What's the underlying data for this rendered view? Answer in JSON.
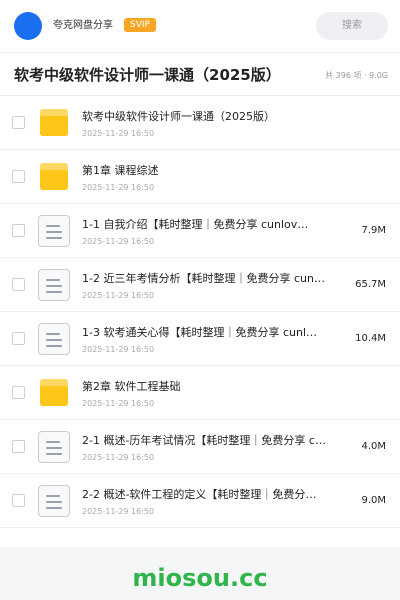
{
  "topbar": {
    "username": "夸克网盘分享",
    "badge": "SVIP",
    "search_label": "搜索",
    "avatar_color": "#1a6ff0"
  },
  "header": {
    "title": "软考中级软件设计师一课通（2025版）",
    "count": "共 396 项 · 9.0G"
  },
  "files": [
    {
      "type": "folder",
      "name": "软考中级软件设计师一课通（2025版）",
      "date": "2025-11-29 16:50",
      "size": ""
    },
    {
      "type": "folder",
      "name": "第1章 课程综述",
      "date": "2025-11-29 16:50",
      "size": ""
    },
    {
      "type": "document",
      "name": "1-1 自我介绍【耗时整理｜免费分享 cunlov…",
      "date": "2025-11-29 16:50",
      "size": "7.9M"
    },
    {
      "type": "document",
      "name": "1-2 近三年考情分析【耗时整理｜免费分享 cun…",
      "date": "2025-11-29 16:50",
      "size": "65.7M"
    },
    {
      "type": "document",
      "name": "1-3 软考通关心得【耗时整理｜免费分享 cunl…",
      "date": "2025-11-29 16:50",
      "size": "10.4M"
    },
    {
      "type": "folder",
      "name": "第2章 软件工程基础",
      "date": "2025-11-29 16:50",
      "size": ""
    },
    {
      "type": "document",
      "name": "2-1 概述-历年考试情况【耗时整理｜免费分享 c…",
      "date": "2025-11-29 16:50",
      "size": "4.0M"
    },
    {
      "type": "document",
      "name": "2-2 概述-软件工程的定义【耗时整理｜免费分享 …",
      "date": "2025-11-29 16:50",
      "size": "9.0M"
    }
  ],
  "watermark": "miosou.cc",
  "colors": {
    "svip_badge": "#f6a623",
    "folder": "#ffc61a",
    "watermark": "#2fb54a"
  }
}
